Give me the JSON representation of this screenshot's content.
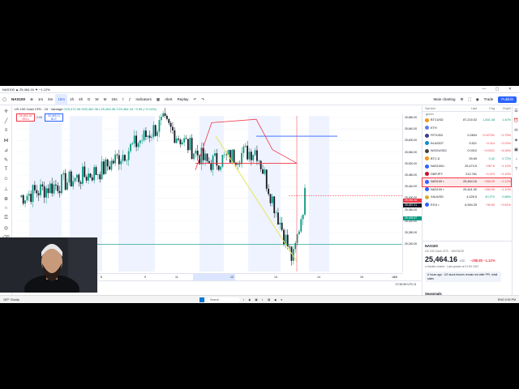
{
  "browser": {
    "tab_title": "NAS100 ▲ 25,464.16 ▼ −1.12%"
  },
  "toolbar": {
    "symbol": "NAS100",
    "intervals": [
      "1m",
      "5m",
      "15m",
      "1h",
      "4h",
      "D",
      "W",
      "M",
      "15s"
    ],
    "active_interval": "15m",
    "indicators": "Indicators",
    "alert": "Alert",
    "replay": "Replay",
    "layout_name": "Main charting",
    "trade": "Trade",
    "publish": "Publish"
  },
  "legend": {
    "title": "US 100 Cash CFD · 15 · Vantage",
    "ohlc": "O25,472.36 H25,482.36 L25,464.36 C25,464.16 −9.95 (−0.04%)",
    "sell": {
      "price": "25,464.16",
      "label": "SELL"
    },
    "buy": {
      "price": "25,465.11",
      "label": "BUY"
    },
    "spread": "0.95"
  },
  "price_axis": {
    "labels": [
      "25,680.00",
      "25,640.00",
      "25,600.00",
      "25,560.00",
      "25,520.00",
      "25,480.00",
      "25,440.00",
      "25,400.00",
      "25,360.00",
      "25,320.00",
      "25,280.00",
      "25,240.00"
    ],
    "current_price": "25,464.16",
    "badge_b": "25,457.21",
    "badge_green": "25,405.57"
  },
  "time_axis": {
    "labels": [
      "8",
      "9",
      "11",
      "12",
      "13",
      "14",
      "15",
      "16",
      "18"
    ],
    "clock": "17:30:30 UTC-5"
  },
  "chart_data": {
    "type": "line",
    "title": "US 100 Cash CFD · 15 · Vantage",
    "x": [
      "8",
      "9",
      "11",
      "12",
      "13",
      "14",
      "15"
    ],
    "series": [
      {
        "values": [
          25460,
          25540,
          25680,
          25560,
          25600,
          25270,
          25464.16
        ]
      }
    ],
    "ylim": [
      25240,
      25700
    ],
    "grid": true
  },
  "watchlist": {
    "headers": [
      "Symbol",
      "Last",
      "Chg",
      "Chg%"
    ],
    "group": "green",
    "rows": [
      {
        "sym": "BTCUSD",
        "last": "87,215.02",
        "chg": "1,831.38",
        "pct": "1.40%",
        "color": "#f7931a",
        "dir": "pos"
      },
      {
        "sym": "ETH",
        "last": "",
        "chg": "",
        "pct": "",
        "color": "#627eea",
        "dir": "pos"
      },
      {
        "sym": "FETUSD",
        "last": "0.2804",
        "chg": "−0.00791",
        "pct": "−2.75%",
        "color": "#3b3b8f",
        "dir": "neg"
      },
      {
        "sym": "INJUSDT",
        "last": "5.521",
        "chg": "−0.114",
        "pct": "−2.02%",
        "color": "#0d8ecf",
        "dir": "neg"
      },
      {
        "sym": "WOOUSDC",
        "last": "0.0310",
        "chg": "−0.0021",
        "pct": "−6.34%",
        "color": "#444",
        "dir": "neg"
      },
      {
        "sym": "BTC.D",
        "last": "59.69",
        "chg": "0.42",
        "pct": "0.72%",
        "color": "#f7931a",
        "dir": "pos"
      },
      {
        "sym": "NAS100U",
        "last": "25,474.5",
        "chg": "−287.6",
        "pct": "−1.12%",
        "color": "#2962ff",
        "dir": "neg"
      },
      {
        "sym": "GBPJPY",
        "last": "212.781",
        "chg": "−0.379",
        "pct": "−0.15%",
        "color": "#c8102e",
        "dir": "neg"
      },
      {
        "sym": "NAS100 ▪",
        "last": "25,464.16",
        "chg": "−288.00",
        "pct": "−1.12%",
        "color": "#2962ff",
        "dir": "neg",
        "selected": true
      },
      {
        "sym": "NAS100 ▪",
        "last": "25,461.90",
        "chg": "−285.90",
        "pct": "−1.10%",
        "color": "#2962ff",
        "dir": "neg"
      },
      {
        "sym": "XAUUSD",
        "last": "4,426.5",
        "chg": "40.270",
        "pct": "0.88%",
        "color": "#d4af37",
        "dir": "pos"
      },
      {
        "sym": "ES1! ▪",
        "last": "6,964.25",
        "chg": "−35.50",
        "pct": "−0.51%",
        "color": "#2962ff",
        "dir": "neg"
      }
    ]
  },
  "details": {
    "symbol": "NAS100",
    "name": "US 100 Cash CFD · VANTAGE",
    "price": "25,464.16",
    "currency": "USD",
    "change": "−288.80 −1.12%",
    "status": "● Market closed · Last update at 21:59 GMT",
    "news": "6 hours ago · US stock futures remain red after PPI, retail sales",
    "seasonals": "Seasonals"
  },
  "taskbar": {
    "weather": "18°F Cloudy",
    "search": "Search",
    "tray": "ENG  5:30 PM"
  }
}
